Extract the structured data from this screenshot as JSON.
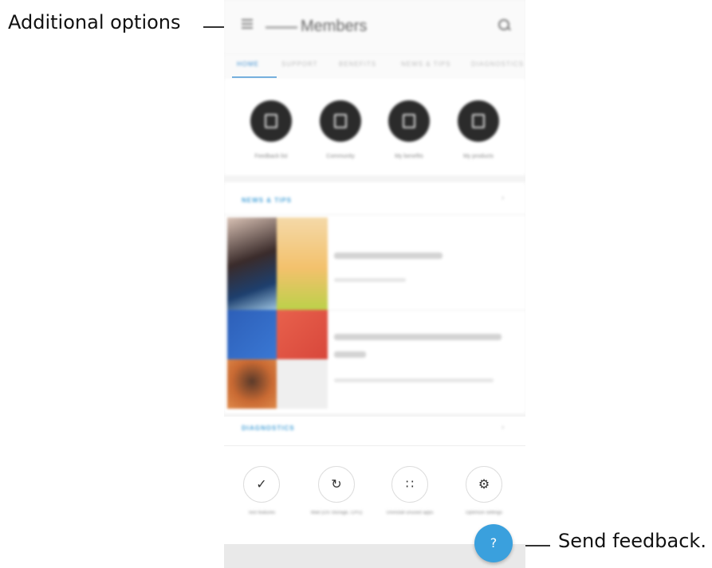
{
  "callouts": {
    "additional_options": "Additional options",
    "send_feedback": "Send feedback."
  },
  "app": {
    "title": "Members",
    "tabs": [
      "HOME",
      "SUPPORT",
      "BENEFITS",
      "NEWS & TIPS",
      "DIAGNOSTICS"
    ],
    "quick_actions": [
      "Feedback list",
      "Community",
      "My benefits",
      "My products"
    ],
    "news_section": {
      "title": "NEWS & TIPS",
      "more": "›"
    },
    "diagnostics_section": {
      "title": "DIAGNOSTICS",
      "more": "›",
      "items": [
        {
          "icon": "check-icon",
          "glyph": "✓",
          "label": "Test features"
        },
        {
          "icon": "refresh-icon",
          "glyph": "↻",
          "label": "Wait (OS Storage, CPU)"
        },
        {
          "icon": "apps-icon",
          "glyph": "∷",
          "label": "Uninstall unused apps"
        },
        {
          "icon": "settings-icon",
          "glyph": "⚙",
          "label": "Optimize settings"
        }
      ]
    },
    "fab_label": "?"
  },
  "colors": {
    "accent": "#3d8fd0",
    "fab": "#3aa0dd",
    "quick_button": "#2b2b2b"
  }
}
